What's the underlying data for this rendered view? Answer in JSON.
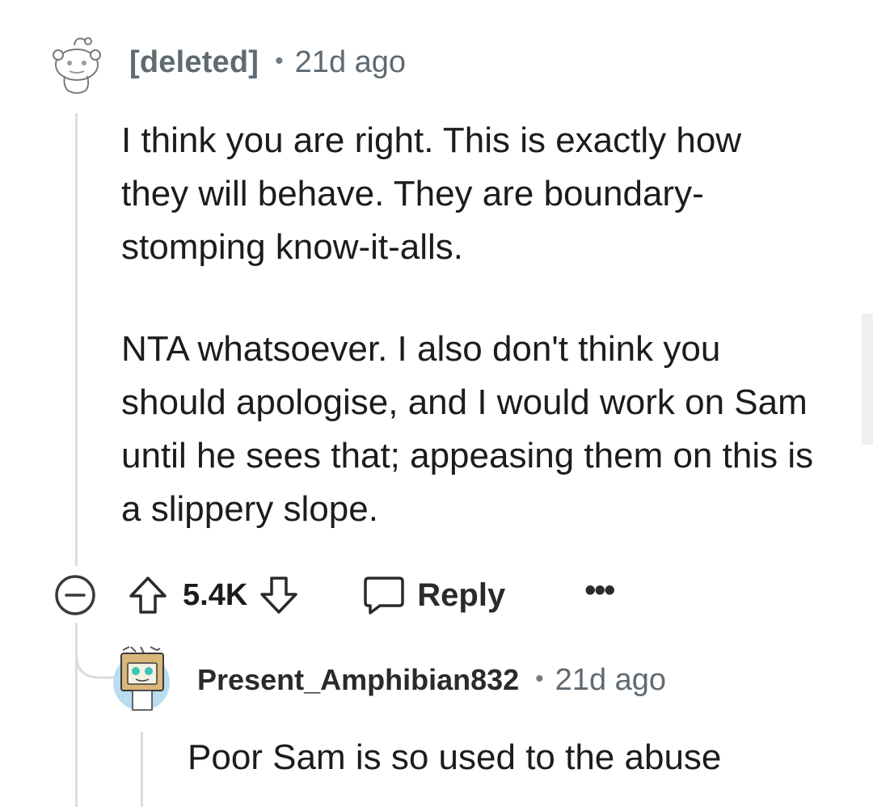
{
  "comment": {
    "author": "[deleted]",
    "separator": "•",
    "time": "21d ago",
    "paragraphs": [
      "I think you are right. This is exactly how they will behave. They are boundary-stomping know-it-alls.",
      "NTA whatsoever. I also don't think you should apologise, and I would work on Sam until he sees that; appeasing them on this is a slippery slope."
    ],
    "score": "5.4K",
    "reply_label": "Reply",
    "more_label": "•••",
    "icons": {
      "avatar": "snoo-avatar-icon",
      "collapse": "collapse-minus-icon",
      "upvote": "upvote-arrow-icon",
      "downvote": "downvote-arrow-icon",
      "reply": "speech-bubble-icon"
    }
  },
  "reply": {
    "author": "Present_Amphibian832",
    "separator": "•",
    "time": "21d ago",
    "text": "Poor Sam is so used to the abuse",
    "icons": {
      "avatar": "box-robot-avatar-icon"
    }
  },
  "colors": {
    "thread_line": "#dcdcdc",
    "meta_text": "#5f6a72",
    "body_text": "#1c1c1c",
    "avatar_bg": "#b9dcef",
    "box_color": "#d9b77a"
  }
}
